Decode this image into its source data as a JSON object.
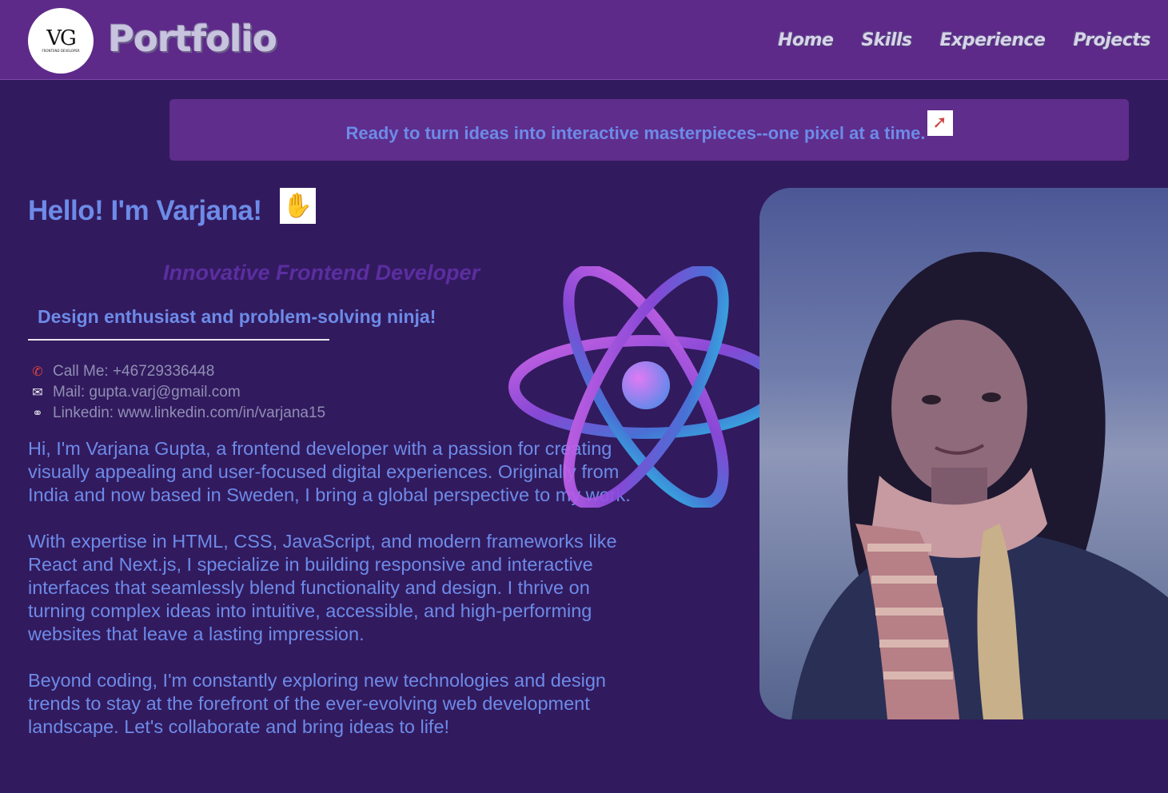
{
  "header": {
    "logo_monogram": "VG",
    "logo_subtitle": "FRONTEND DEVELOPER",
    "brand": "Portfolio",
    "nav": [
      "Home",
      "Skills",
      "Experience",
      "Projects"
    ]
  },
  "banner": {
    "text": "Ready to turn ideas into interactive masterpieces--one pixel at a time.",
    "emoji": "rocket-icon"
  },
  "hero": {
    "greeting": "Hello! I'm Varjana!",
    "greeting_emoji": "waving-hand-icon",
    "role": "Innovative Frontend Developer",
    "tagline": "Design enthusiast and problem-solving ninja!"
  },
  "contacts": [
    {
      "icon": "phone-icon",
      "label": "Call Me: +46729336448"
    },
    {
      "icon": "mail-icon",
      "label": "Mail: gupta.varj@gmail.com"
    },
    {
      "icon": "link-icon",
      "label": "Linkedin: www.linkedin.com/in/varjana15"
    }
  ],
  "about": [
    "Hi, I'm Varjana Gupta, a frontend developer with a passion for creating visually appealing and user-focused digital experiences. Originally from India and now based in Sweden, I bring a global perspective to my work.",
    "With expertise in HTML, CSS, JavaScript, and modern frameworks like React and Next.js, I specialize in building responsive and interactive interfaces that seamlessly blend functionality and design. I thrive on turning complex ideas into intuitive, accessible, and high-performing websites that leave a lasting impression.",
    "Beyond coding, I'm constantly exploring new technologies and design trends to stay at the forefront of the ever-evolving web development landscape. Let's collaborate and bring ideas to life!"
  ],
  "colors": {
    "background": "#321a5e",
    "header": "#5e2a8a",
    "accent_text": "#6d8be8",
    "role_text": "#5b2ea0"
  }
}
